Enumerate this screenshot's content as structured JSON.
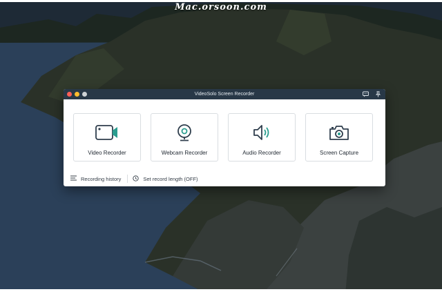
{
  "watermark": "Mac.orsoon.com",
  "window": {
    "title": "VideoSolo Screen Recorder",
    "titlebar_icons": [
      "feedback-icon",
      "pin-icon"
    ]
  },
  "cards": [
    {
      "label": "Video Recorder",
      "icon": "video-camera-icon"
    },
    {
      "label": "Webcam Recorder",
      "icon": "webcam-icon"
    },
    {
      "label": "Audio Recorder",
      "icon": "speaker-icon"
    },
    {
      "label": "Screen Capture",
      "icon": "camera-icon"
    }
  ],
  "bottom_bar": {
    "history_label": "Recording history",
    "record_length_label": "Set record length (OFF)"
  },
  "colors": {
    "titlebar": "#283847",
    "accent": "#2a9d8f",
    "icon_dark": "#2e3d4c"
  }
}
